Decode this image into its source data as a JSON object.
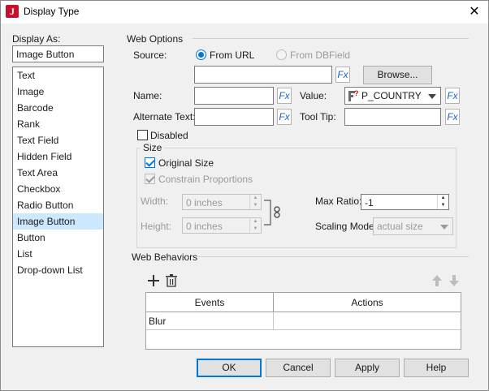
{
  "window": {
    "title": "Display Type",
    "close_glyph": "✕",
    "app_icon_letter": "J"
  },
  "display_as": {
    "label": "Display As:",
    "current_value": "Image Button",
    "items": [
      "Text",
      "Image",
      "Barcode",
      "Rank",
      "Text Field",
      "Hidden Field",
      "Text Area",
      "Checkbox",
      "Radio Button",
      "Image Button",
      "Button",
      "List",
      "Drop-down List"
    ],
    "selected_index": 9
  },
  "web_options": {
    "group_label": "Web Options",
    "source_label": "Source:",
    "from_url_label": "From URL",
    "from_dbfield_label": "From DBField",
    "url_value": "",
    "browse_label": "Browse...",
    "name_label": "Name:",
    "name_value": "",
    "value_label": "Value:",
    "value_value": "P_COUNTRY",
    "alternate_text_label": "Alternate Text:",
    "alternate_text_value": "",
    "tool_tip_label": "Tool Tip:",
    "tool_tip_value": "",
    "disabled_label": "Disabled",
    "fx_label": "Fx"
  },
  "size": {
    "group_label": "Size",
    "original_size_label": "Original Size",
    "constrain_label": "Constrain Proportions",
    "width_label": "Width:",
    "width_value": "0 inches",
    "height_label": "Height:",
    "height_value": "0 inches",
    "max_ratio_label": "Max Ratio:",
    "max_ratio_value": "-1",
    "scaling_mode_label": "Scaling Mode:",
    "scaling_mode_value": "actual size"
  },
  "web_behaviors": {
    "group_label": "Web Behaviors",
    "columns": [
      "Events",
      "Actions"
    ],
    "rows": [
      [
        "Blur",
        ""
      ]
    ]
  },
  "footer": {
    "ok_label": "OK",
    "cancel_label": "Cancel",
    "apply_label": "Apply",
    "help_label": "Help"
  },
  "colors": {
    "accent": "#0078d7",
    "selection": "#cce8ff",
    "fx_blue": "#1c60c8",
    "app_icon_red": "#c8102e"
  }
}
